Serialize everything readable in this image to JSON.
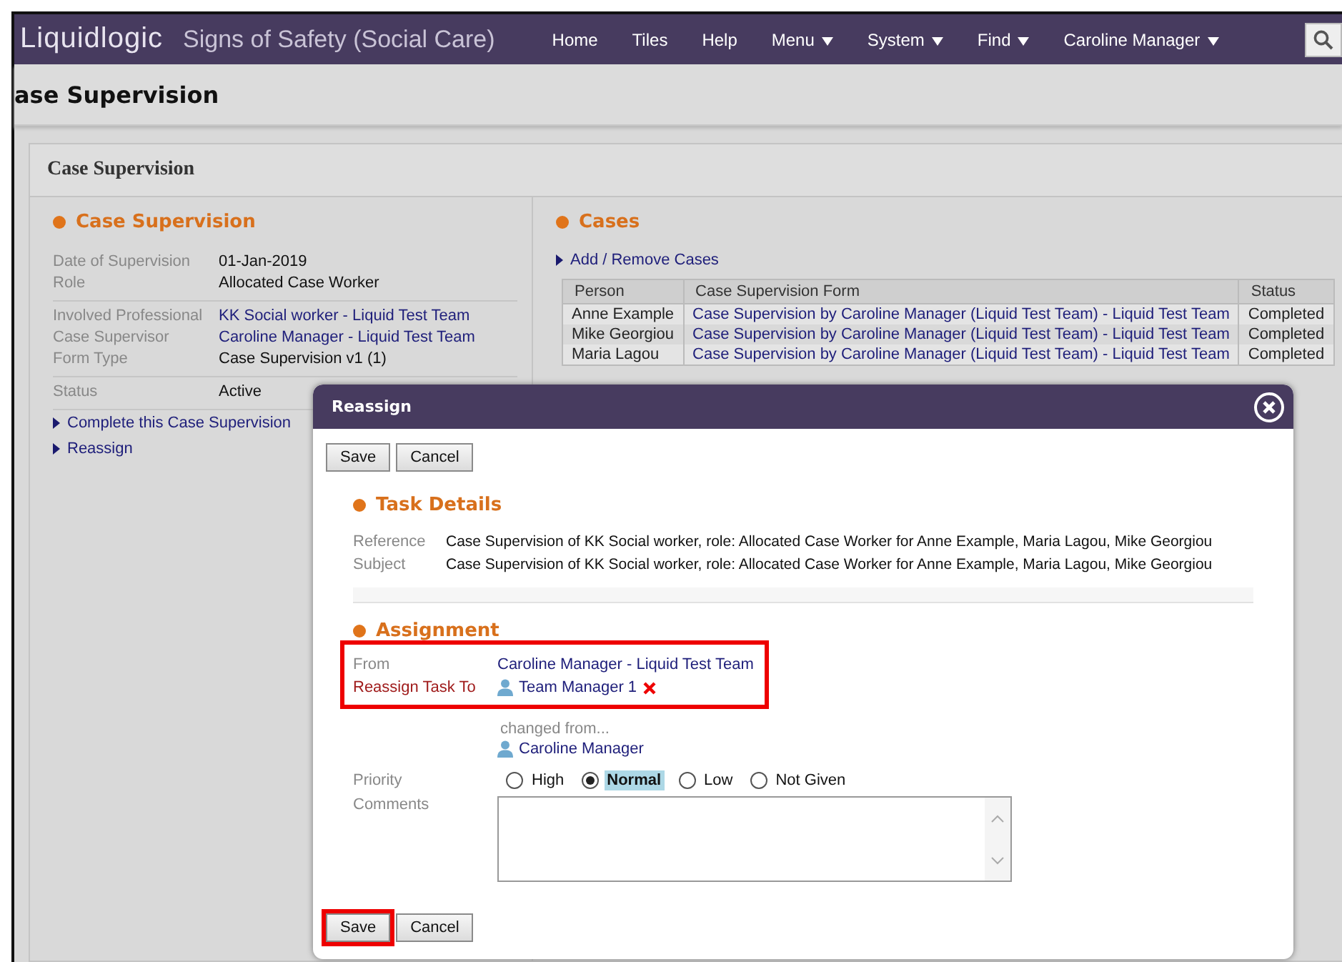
{
  "app": {
    "logo": "Liquidlogic",
    "title": "Signs of Safety (Social Care)",
    "nav": [
      {
        "label": "Home",
        "dropdown": false
      },
      {
        "label": "Tiles",
        "dropdown": false
      },
      {
        "label": "Help",
        "dropdown": false
      },
      {
        "label": "Menu",
        "dropdown": true
      },
      {
        "label": "System",
        "dropdown": true
      },
      {
        "label": "Find",
        "dropdown": true
      },
      {
        "label": "Caroline Manager",
        "dropdown": true
      }
    ]
  },
  "page_title": "ase Supervision",
  "panel": {
    "title": "Case Supervision",
    "details": {
      "heading": "Case Supervision",
      "groups": [
        [
          {
            "label": "Date of Supervision",
            "value": "01-Jan-2019",
            "link": false
          },
          {
            "label": "Role",
            "value": "Allocated Case Worker",
            "link": false
          }
        ],
        [
          {
            "label": "Involved Professional",
            "value": "KK Social worker - Liquid Test Team",
            "link": true
          },
          {
            "label": "Case Supervisor",
            "value": "Caroline Manager - Liquid Test Team",
            "link": true
          },
          {
            "label": "Form Type",
            "value": "Case Supervision v1 (1)",
            "link": false
          }
        ],
        [
          {
            "label": "Status",
            "value": "Active",
            "link": false
          }
        ]
      ],
      "actions": [
        "Complete this Case Supervision",
        "Reassign"
      ]
    },
    "cases": {
      "heading": "Cases",
      "action": "Add / Remove Cases",
      "columns": [
        "Person",
        "Case Supervision Form",
        "Status"
      ],
      "rows": [
        [
          "Anne Example",
          "Case Supervision by Caroline Manager (Liquid Test Team) - Liquid Test Team",
          "Completed"
        ],
        [
          "Mike Georgiou",
          "Case Supervision by Caroline Manager (Liquid Test Team) - Liquid Test Team",
          "Completed"
        ],
        [
          "Maria Lagou",
          "Case Supervision by Caroline Manager (Liquid Test Team) - Liquid Test Team",
          "Completed"
        ]
      ]
    }
  },
  "dialog": {
    "title": "Reassign",
    "top_buttons": [
      "Save",
      "Cancel"
    ],
    "task_details": {
      "heading": "Task Details",
      "rows": [
        {
          "label": "Reference",
          "value": "Case Supervision of KK Social worker, role: Allocated Case Worker for Anne Example, Maria Lagou, Mike Georgiou"
        },
        {
          "label": "Subject",
          "value": "Case Supervision of KK Social worker, role: Allocated Case Worker for Anne Example, Maria Lagou, Mike Georgiou"
        }
      ]
    },
    "assignment": {
      "heading": "Assignment",
      "highlighted": true,
      "from_label": "From",
      "from": "Caroline Manager - Liquid Test Team",
      "to_label": "Reassign Task To",
      "to": "Team Manager 1",
      "changed_note": "changed from...",
      "changed_from": "Caroline Manager"
    },
    "priority": {
      "label": "Priority",
      "options": [
        {
          "label": "High",
          "selected": false
        },
        {
          "label": "Normal",
          "selected": true
        },
        {
          "label": "Low",
          "selected": false
        },
        {
          "label": "Not Given",
          "selected": false
        }
      ]
    },
    "comments": {
      "label": "Comments"
    },
    "bottom_buttons": [
      {
        "label": "Save",
        "highlighted": true
      },
      {
        "label": "Cancel",
        "highlighted": false
      }
    ]
  }
}
